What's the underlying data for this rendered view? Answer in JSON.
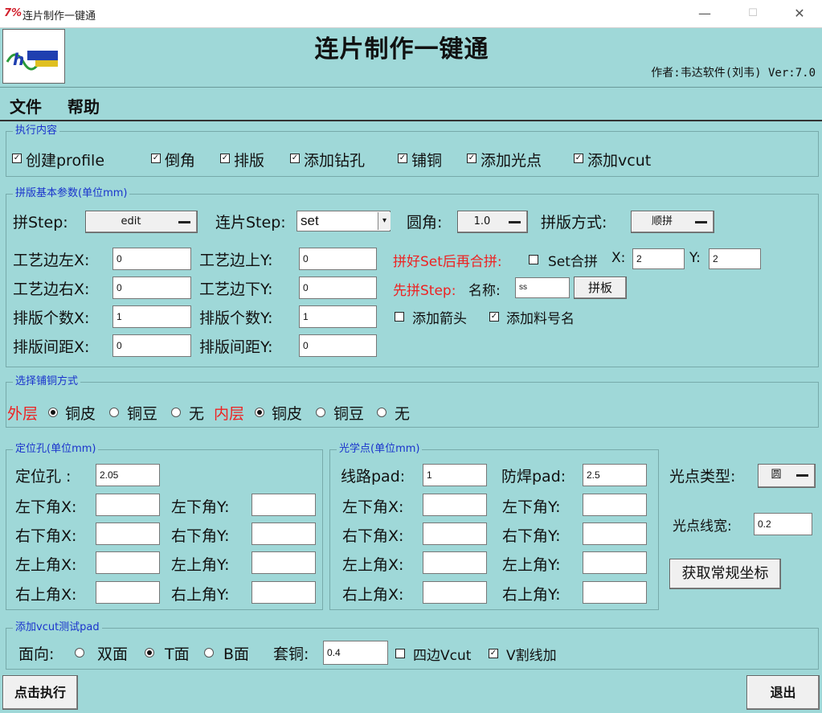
{
  "window": {
    "title": "连片制作一键通",
    "logo_text": "7%",
    "min_glyph": "—",
    "max_glyph": "☐",
    "close_glyph": "✕"
  },
  "header": {
    "title": "连片制作一键通",
    "author": "作者:韦达软件(刘韦)  Ver:7.0"
  },
  "menu": {
    "file": "文件",
    "help": "帮助"
  },
  "exec": {
    "title": "执行内容",
    "items": [
      {
        "label": "创建profile",
        "checked": true
      },
      {
        "label": "倒角",
        "checked": true
      },
      {
        "label": "排版",
        "checked": true
      },
      {
        "label": "添加钻孔",
        "checked": true
      },
      {
        "label": "铺铜",
        "checked": true
      },
      {
        "label": "添加光点",
        "checked": true
      },
      {
        "label": "添加vcut",
        "checked": true
      }
    ]
  },
  "panel": {
    "title": "拼版基本参数(单位mm)",
    "pin_step_label": "拼Step:",
    "pin_step_value": "edit",
    "lian_step_label": "连片Step:",
    "lian_step_value": "set",
    "corner_label": "圆角:",
    "corner_value": "1.0",
    "mode_label": "拼版方式:",
    "mode_value": "顺拼",
    "left_x_label": "工艺边左X:",
    "left_x": "0",
    "up_y_label": "工艺边上Y:",
    "up_y": "0",
    "right_x_label": "工艺边右X:",
    "right_x": "0",
    "down_y_label": "工艺边下Y:",
    "down_y": "0",
    "count_x_label": "排版个数X:",
    "count_x": "1",
    "count_y_label": "排版个数Y:",
    "count_y": "1",
    "gap_x_label": "排版间距X:",
    "gap_x": "0",
    "gap_y_label": "排版间距Y:",
    "gap_y": "0",
    "merge_label": "拼好Set后再合拼:",
    "set_merge_label": "Set合拼",
    "set_merge_checked": false,
    "merge_x_label": "X:",
    "merge_x": "2",
    "merge_y_label": "Y:",
    "merge_y": "2",
    "pre_step_label": "先拼Step:",
    "name_label": "名称:",
    "name_value": "ss",
    "pinban_button": "拼板",
    "arrow_label": "添加箭头",
    "arrow_checked": false,
    "partname_label": "添加料号名",
    "partname_checked": true
  },
  "copper": {
    "title": "选择铺铜方式",
    "outer_label": "外层",
    "inner_label": "内层",
    "opt_skin": "铜皮",
    "opt_bean": "铜豆",
    "opt_none": "无",
    "outer_selected": "铜皮",
    "inner_selected": "铜皮"
  },
  "holes": {
    "title": "定位孔(单位mm)",
    "hole_label": "定位孔  :",
    "hole_value": "2.05",
    "rows": [
      {
        "xlabel": "左下角X:",
        "ylabel": "左下角Y:",
        "x": "",
        "y": ""
      },
      {
        "xlabel": "右下角X:",
        "ylabel": "右下角Y:",
        "x": "",
        "y": ""
      },
      {
        "xlabel": "左上角X:",
        "ylabel": "左上角Y:",
        "x": "",
        "y": ""
      },
      {
        "xlabel": "右上角X:",
        "ylabel": "右上角Y:",
        "x": "",
        "y": ""
      }
    ]
  },
  "fiducial": {
    "title": "光学点(单位mm)",
    "pad_label": "线路pad:",
    "pad_value": "1",
    "mask_label": "防焊pad:",
    "mask_value": "2.5",
    "rows": [
      {
        "xlabel": "左下角X:",
        "ylabel": "左下角Y:",
        "x": "",
        "y": ""
      },
      {
        "xlabel": "右下角X:",
        "ylabel": "右下角Y:",
        "x": "",
        "y": ""
      },
      {
        "xlabel": "左上角X:",
        "ylabel": "左上角Y:",
        "x": "",
        "y": ""
      },
      {
        "xlabel": "右上角X:",
        "ylabel": "右上角Y:",
        "x": "",
        "y": ""
      }
    ],
    "type_label": "光点类型:",
    "type_value": "圆",
    "width_label": "光点线宽:",
    "width_value": "0.2",
    "get_coords_button": "获取常规坐标"
  },
  "vcut": {
    "title": "添加vcut测试pad",
    "face_label": "面向:",
    "double": "双面",
    "t_face": "T面",
    "b_face": "B面",
    "face_selected": "T面",
    "copper_label": "套铜:",
    "copper_value": "0.4",
    "four_edge_label": "四边Vcut",
    "four_edge_checked": false,
    "v_line_label": "V割线加",
    "v_line_checked": true
  },
  "footer": {
    "run_button": "点击执行",
    "exit_button": "退出"
  }
}
